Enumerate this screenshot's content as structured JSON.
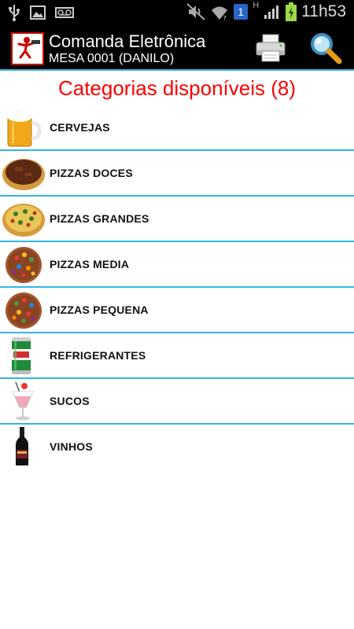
{
  "status_bar": {
    "time": "11h53",
    "sim_badge": "1",
    "network_type": "H",
    "icons": [
      "usb-icon",
      "image-icon",
      "voicemail-icon",
      "mute-icon",
      "wifi-icon",
      "signal-icon",
      "battery-charging-icon"
    ]
  },
  "action_bar": {
    "title": "Comanda Eletrônica",
    "subtitle": "MESA 0001 (DANILO)",
    "actions": [
      "printer-icon",
      "search-icon"
    ]
  },
  "heading": "Categorias disponíveis (8)",
  "categories": [
    {
      "label": "CERVEJAS",
      "icon": "beer-mug-icon"
    },
    {
      "label": "PIZZAS DOCES",
      "icon": "chocolate-pizza-icon"
    },
    {
      "label": "PIZZAS GRANDES",
      "icon": "large-pizza-icon"
    },
    {
      "label": "PIZZAS MEDIA",
      "icon": "candy-pizza-icon"
    },
    {
      "label": "PIZZAS PEQUENA",
      "icon": "candy-pizza-icon"
    },
    {
      "label": "REFRIGERANTES",
      "icon": "soda-can-icon"
    },
    {
      "label": "SUCOS",
      "icon": "juice-glass-icon"
    },
    {
      "label": "VINHOS",
      "icon": "wine-bottle-icon"
    }
  ],
  "colors": {
    "accent": "#33b5e5",
    "heading": "#ff0000",
    "bar": "#000000"
  }
}
